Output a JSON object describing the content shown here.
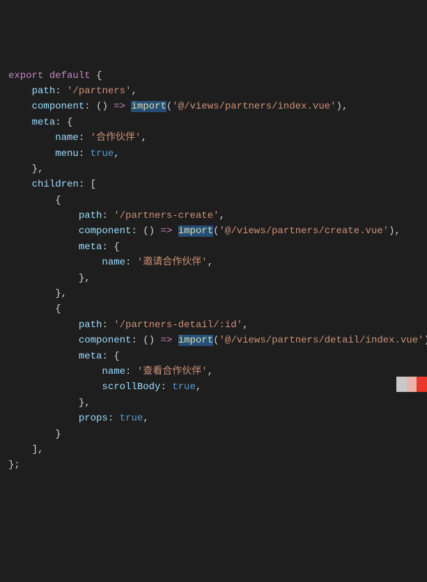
{
  "tokens": [
    [
      [
        "export ",
        "kw"
      ],
      [
        "default ",
        "kw"
      ],
      [
        "{",
        "punc"
      ]
    ],
    [
      [
        "    ",
        ""
      ],
      [
        "path",
        "key"
      ],
      [
        ": ",
        "punc"
      ],
      [
        "'/partners'",
        "str"
      ],
      [
        ",",
        "punc"
      ]
    ],
    [
      [
        "    ",
        ""
      ],
      [
        "component",
        "key"
      ],
      [
        ": () ",
        "punc"
      ],
      [
        "=>",
        "kw"
      ],
      [
        " ",
        ""
      ],
      [
        "import",
        "sel"
      ],
      [
        "(",
        "punc"
      ],
      [
        "'@/views/partners/index.vue'",
        "str"
      ],
      [
        "),",
        "punc"
      ]
    ],
    [
      [
        "    ",
        ""
      ],
      [
        "meta",
        "key"
      ],
      [
        ": {",
        "punc"
      ]
    ],
    [
      [
        "        ",
        ""
      ],
      [
        "name",
        "key"
      ],
      [
        ": ",
        "punc"
      ],
      [
        "'合作伙伴'",
        "str"
      ],
      [
        ",",
        "punc"
      ]
    ],
    [
      [
        "        ",
        ""
      ],
      [
        "menu",
        "key"
      ],
      [
        ": ",
        "punc"
      ],
      [
        "true",
        "bool"
      ],
      [
        ",",
        "punc"
      ]
    ],
    [
      [
        "    },",
        "punc"
      ]
    ],
    [
      [
        "    ",
        ""
      ],
      [
        "children",
        "key"
      ],
      [
        ": [",
        "punc"
      ]
    ],
    [
      [
        "        {",
        "punc"
      ]
    ],
    [
      [
        "            ",
        ""
      ],
      [
        "path",
        "key"
      ],
      [
        ": ",
        "punc"
      ],
      [
        "'/partners-create'",
        "str"
      ],
      [
        ",",
        "punc"
      ]
    ],
    [
      [
        "            ",
        ""
      ],
      [
        "component",
        "key"
      ],
      [
        ": () ",
        "punc"
      ],
      [
        "=>",
        "kw"
      ],
      [
        " ",
        ""
      ],
      [
        "import",
        "sel"
      ],
      [
        "(",
        "punc"
      ],
      [
        "'@/views/partners/create.vue'",
        "str"
      ],
      [
        "),",
        "punc"
      ]
    ],
    [
      [
        "            ",
        ""
      ],
      [
        "meta",
        "key"
      ],
      [
        ": {",
        "punc"
      ]
    ],
    [
      [
        "                ",
        ""
      ],
      [
        "name",
        "key"
      ],
      [
        ": ",
        "punc"
      ],
      [
        "'邀请合作伙伴'",
        "str"
      ],
      [
        ",",
        "punc"
      ]
    ],
    [
      [
        "            },",
        "punc"
      ]
    ],
    [
      [
        "        },",
        "punc"
      ]
    ],
    [
      [
        "        {",
        "punc"
      ]
    ],
    [
      [
        "            ",
        ""
      ],
      [
        "path",
        "key"
      ],
      [
        ": ",
        "punc"
      ],
      [
        "'/partners-detail/:id'",
        "str"
      ],
      [
        ",",
        "punc"
      ]
    ],
    [
      [
        "            ",
        ""
      ],
      [
        "component",
        "key"
      ],
      [
        ": () ",
        "punc"
      ],
      [
        "=>",
        "kw"
      ],
      [
        " ",
        ""
      ],
      [
        "import",
        "sel"
      ],
      [
        "(",
        "punc"
      ],
      [
        "'@/views/partners/detail/index.vue'",
        "str"
      ],
      [
        "),",
        "punc"
      ]
    ],
    [
      [
        "            ",
        ""
      ],
      [
        "meta",
        "key"
      ],
      [
        ": {",
        "punc"
      ]
    ],
    [
      [
        "                ",
        ""
      ],
      [
        "name",
        "key"
      ],
      [
        ": ",
        "punc"
      ],
      [
        "'查看合作伙伴'",
        "str"
      ],
      [
        ",",
        "punc"
      ]
    ],
    [
      [
        "                ",
        ""
      ],
      [
        "scrollBody",
        "key"
      ],
      [
        ": ",
        "punc"
      ],
      [
        "true",
        "bool"
      ],
      [
        ",",
        "punc"
      ]
    ],
    [
      [
        "            },",
        "punc"
      ]
    ],
    [
      [
        "            ",
        ""
      ],
      [
        "props",
        "key"
      ],
      [
        ": ",
        "punc"
      ],
      [
        "true",
        "bool"
      ],
      [
        ",",
        "punc"
      ]
    ],
    [
      [
        "        }",
        "punc"
      ]
    ],
    [
      [
        "    ],",
        "punc"
      ]
    ],
    [
      [
        "};",
        "punc"
      ]
    ]
  ]
}
